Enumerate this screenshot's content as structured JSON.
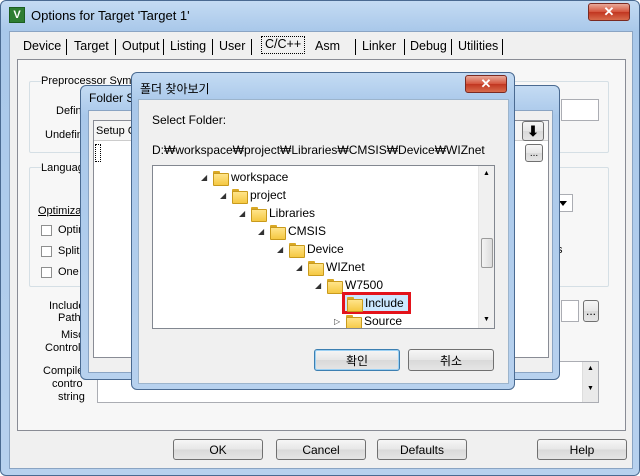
{
  "main": {
    "title": "Options for Target 'Target 1'",
    "close": "✕",
    "tabs": [
      "Device",
      "Target",
      "Output",
      "Listing",
      "User",
      "C/C++",
      "Asm",
      "Linker",
      "Debug",
      "Utilities"
    ],
    "preproc_label": "Preprocessor Symb",
    "define_label": "Defin",
    "undefine_label": "Undefin",
    "language_label": "Languag",
    "optim_label": "Optimizat",
    "checks": [
      "Optin",
      "Split",
      "One"
    ],
    "include_label_1": "Include",
    "include_label_2": "Paths",
    "misc_label_1": "Misc",
    "misc_label_2": "Controls",
    "compiler_label_1": "Compile",
    "compiler_label_2": "contro",
    "compiler_label_3": "string",
    "right_partial": "s",
    "ellipsis": "...",
    "buttons": {
      "ok": "OK",
      "cancel": "Cancel",
      "defaults": "Defaults",
      "help": "Help"
    }
  },
  "folder_setup": {
    "title": "Folder S",
    "header": "Setup C",
    "down_arrow": "⬇",
    "ellipsis": "..."
  },
  "browse": {
    "title": "폴더 찾아보기",
    "close": "✕",
    "prompt": "Select Folder:",
    "path": "D:₩workspace₩project₩Libraries₩CMSIS₩Device₩WIZnet",
    "tree": [
      {
        "label": "workspace",
        "indent": 0
      },
      {
        "label": "project",
        "indent": 1
      },
      {
        "label": "Libraries",
        "indent": 2
      },
      {
        "label": "CMSIS",
        "indent": 3
      },
      {
        "label": "Device",
        "indent": 4
      },
      {
        "label": "WIZnet",
        "indent": 5
      },
      {
        "label": "W7500",
        "indent": 6
      },
      {
        "label": "Include",
        "indent": 7,
        "selected": true
      },
      {
        "label": "Source",
        "indent": 7,
        "collapsed": true
      }
    ],
    "ok": "확인",
    "cancel": "취소"
  },
  "colors": {
    "highlight": "#e3131b",
    "selection": "#cce8ff",
    "close_red": "#c13620"
  }
}
